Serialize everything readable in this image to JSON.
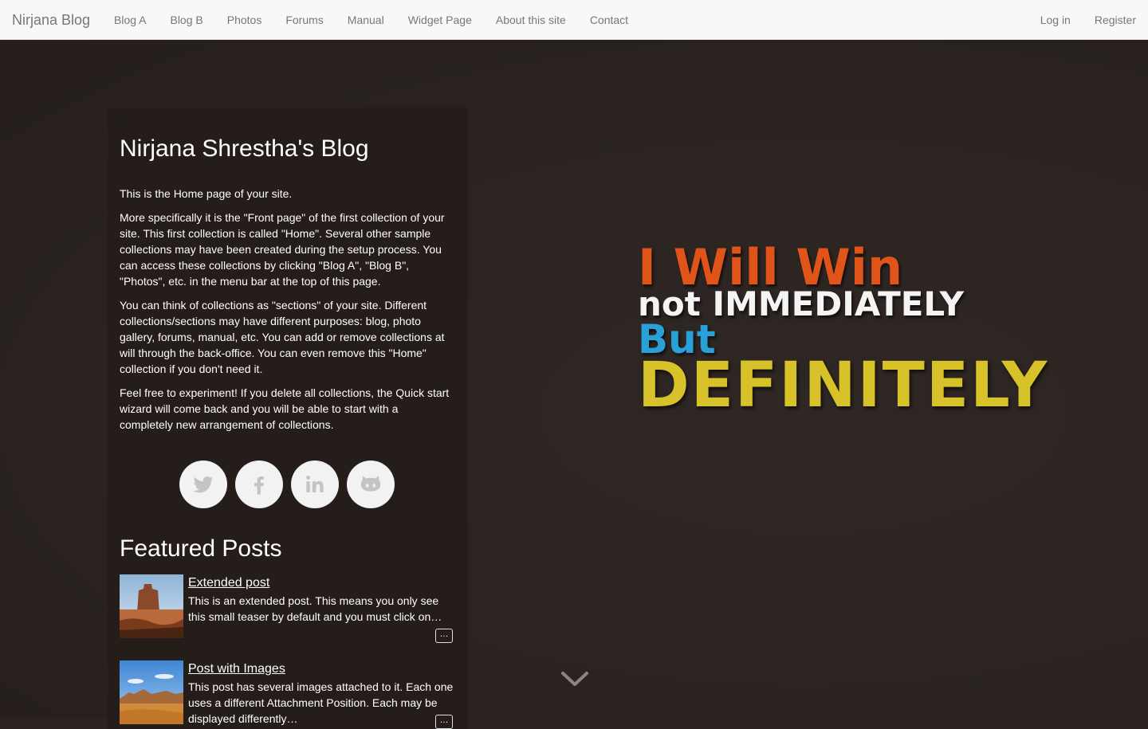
{
  "navbar": {
    "brand": "Nirjana Blog",
    "items": [
      "Blog A",
      "Blog B",
      "Photos",
      "Forums",
      "Manual",
      "Widget Page",
      "About this site",
      "Contact"
    ],
    "right_items": [
      "Log in",
      "Register"
    ]
  },
  "hero": {
    "quote_line1": "I Will Win",
    "quote_line2": "not IMMEDIATELY",
    "quote_line3": "But",
    "quote_line4": "DEFINITELY"
  },
  "panel": {
    "title": "Nirjana Shrestha's Blog",
    "paragraphs": [
      "This is the Home page of your site.",
      "More specifically it is the \"Front page\" of the first collection of your site. This first collection is called \"Home\". Several other sample collections may have been created during the setup process. You can access these collections by clicking \"Blog A\", \"Blog B\", \"Photos\", etc. in the menu bar at the top of this page.",
      "You can think of collections as \"sections\" of your site. Different collections/sections may have different purposes: blog, photo gallery, forums, manual, etc. You can add or remove collections at will through the back-office. You can even remove this \"Home\" collection if you don't need it.",
      "Feel free to experiment! If you delete all collections, the Quick start wizard will come back and you will be able to start with a completely new arrangement of collections."
    ],
    "social_icons": [
      "twitter-icon",
      "facebook-icon",
      "linkedin-icon",
      "github-icon"
    ],
    "featured_title": "Featured Posts",
    "posts": [
      {
        "title": "Extended post",
        "excerpt": "This is an extended post. This means you only see this small teaser by default and you must click on…",
        "more": "…"
      },
      {
        "title": "Post with Images",
        "excerpt": "This post has several images attached to it. Each one uses a different Attachment Position. Each may be displayed differently…",
        "more": "…"
      }
    ]
  },
  "colors": {
    "navbar_bg": "#f8f8f8",
    "nav_text": "#777777",
    "page_bg": "#2a2320",
    "quote_orange": "#e0541a",
    "quote_blue": "#2aa0d8",
    "quote_yellow": "#d8c22a"
  }
}
